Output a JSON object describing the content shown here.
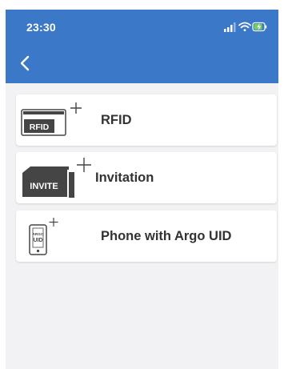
{
  "status_bar": {
    "time": "23:30",
    "icons": [
      "signal-icon",
      "wifi-icon",
      "battery-charging-icon"
    ]
  },
  "header": {
    "back_icon": "chevron-left-icon",
    "background_color": "#3c78c8"
  },
  "options": [
    {
      "label": "RFID",
      "icon": "rfid-card-add-icon",
      "icon_text": "RFID"
    },
    {
      "label": "Invitation",
      "icon": "invitation-card-add-icon",
      "icon_text": "INVITE"
    },
    {
      "label": "Phone with Argo UID",
      "icon": "phone-uid-add-icon",
      "icon_text_top": "ARGO",
      "icon_text_bottom": "UID"
    }
  ],
  "colors": {
    "accent": "#3c78c8",
    "background": "#f2f2f4",
    "card": "#ffffff",
    "text": "#333333",
    "icon_dark": "#454545"
  }
}
